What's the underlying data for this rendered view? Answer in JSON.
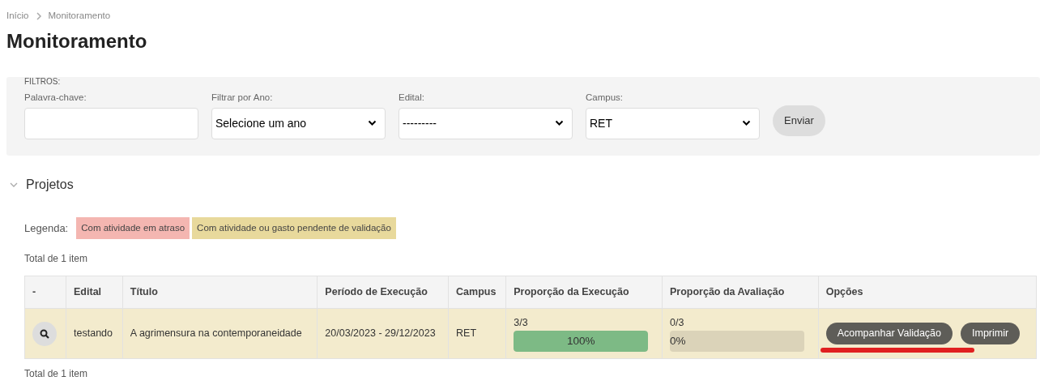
{
  "breadcrumb": [
    {
      "label": "Início"
    },
    {
      "label": "Monitoramento"
    }
  ],
  "title": "Monitoramento",
  "filters": {
    "legend": "FILTROS:",
    "fields": [
      {
        "kind": "text",
        "label": "Palavra-chave:"
      },
      {
        "kind": "select",
        "label": "Filtrar por Ano:",
        "value": "Selecione um ano"
      },
      {
        "kind": "select",
        "label": "Edital:",
        "value": "---------"
      },
      {
        "kind": "select",
        "label": "Campus:",
        "value": "RET"
      }
    ],
    "submit": "Enviar"
  },
  "section": {
    "title": "Projetos",
    "expanded": true
  },
  "legend": {
    "label": "Legenda:",
    "items": [
      {
        "label": "Com atividade em atraso",
        "color": "#f4b6b1"
      },
      {
        "label": "Com atividade ou gasto pendente de validação",
        "color": "#e8d99c"
      }
    ]
  },
  "total_top": "Total de 1 item",
  "table": {
    "columns": [
      "-",
      "Edital",
      "Título",
      "Período de Execução",
      "Campus",
      "Proporção da Execução",
      "Proporção da Avaliação",
      "Opções"
    ],
    "rows": [
      {
        "color": "#f3ebcd",
        "edital": "testando",
        "titulo": "A agrimensura na contemporaneidade",
        "periodo": "20/03/2023 - 29/12/2023",
        "campus": "RET",
        "execucao": {
          "count": "3/3",
          "level": 1,
          "reading": "100%"
        },
        "avaliacao": {
          "count": "0/3",
          "level": 0,
          "reading": "0%"
        },
        "options": [
          "Acompanhar Validação",
          "Imprimir"
        ]
      }
    ]
  },
  "total_bottom": "Total de 1 item"
}
